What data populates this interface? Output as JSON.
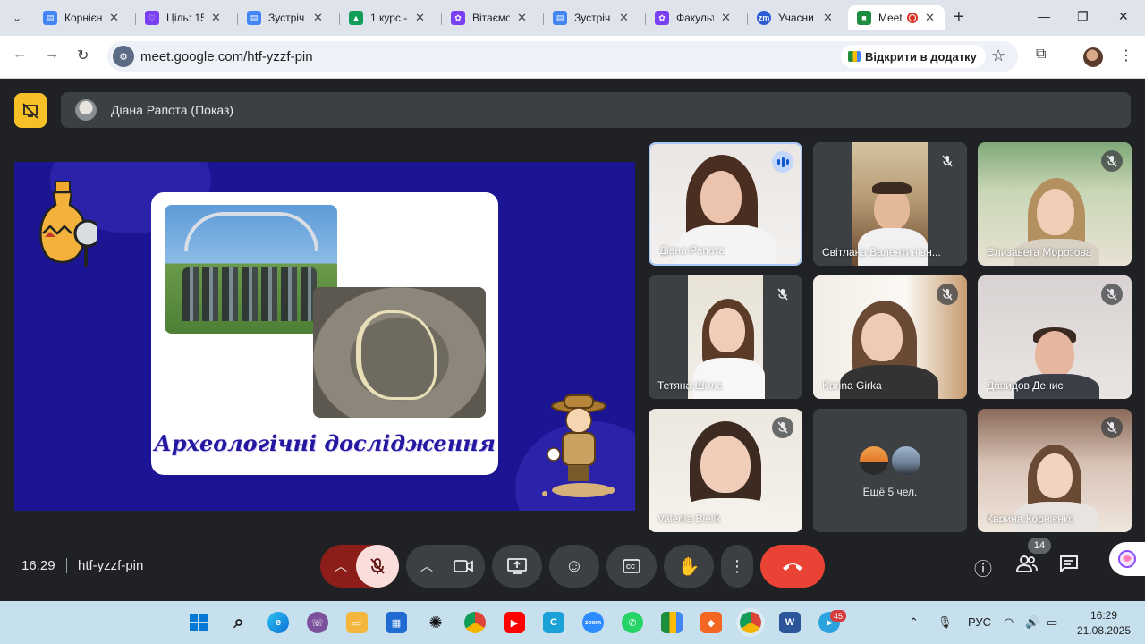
{
  "browser": {
    "tabs": [
      {
        "title": "Корнієнко",
        "color": "#4285f4",
        "glyph": "▤"
      },
      {
        "title": "Ціль: 15",
        "color": "#7b3ff2",
        "glyph": "♡"
      },
      {
        "title": "Зустріч",
        "color": "#4285f4",
        "glyph": "▤"
      },
      {
        "title": "1 курс -",
        "color": "#0f9d58",
        "glyph": "▲"
      },
      {
        "title": "Вітаємо",
        "color": "#7b3ff2",
        "glyph": "✿"
      },
      {
        "title": "Зустріч",
        "color": "#4285f4",
        "glyph": "▤"
      },
      {
        "title": "Факульт",
        "color": "#7b3ff2",
        "glyph": "✿"
      },
      {
        "title": "Учасни",
        "color": "#2d5bd6",
        "glyph": "zm"
      },
      {
        "title": "Meet",
        "color": "#1e8e3e",
        "glyph": "■"
      }
    ],
    "url": "meet.google.com/htf-yzzf-pin",
    "open_in_app_label": "Відкрити в додатку"
  },
  "meet": {
    "presenter_label": "Діана Рапота (Показ)",
    "slide_title": "Археологічні дослідження",
    "participants": [
      {
        "name": "Діана Рапота"
      },
      {
        "name": "Світлана Валентинівн..."
      },
      {
        "name": "Єлизавета Морозова"
      },
      {
        "name": "Тетяна Шило"
      },
      {
        "name": "Karina Girka"
      },
      {
        "name": "Давидов Денис"
      },
      {
        "name": "Valeriia Bielik"
      },
      {
        "name": "Карина Корнієнко"
      }
    ],
    "more_label": "Ещё 5 чел.",
    "time": "16:29",
    "meeting_code": "htf-yzzf-pin",
    "people_count": "14"
  },
  "taskbar": {
    "lang": "РУС",
    "time": "16:29",
    "date": "21.08.2025",
    "telegram_badge": "45"
  },
  "colors": {
    "meet_bg": "#202124",
    "slide_bg": "#1c1593",
    "end_call": "#ea4335",
    "accent_yellow": "#f6c026"
  }
}
